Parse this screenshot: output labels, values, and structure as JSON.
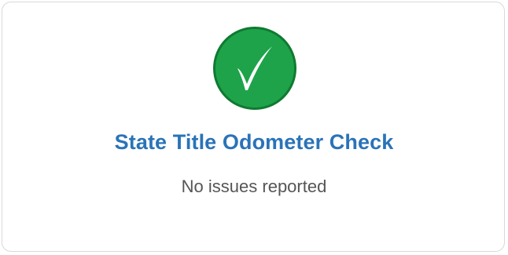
{
  "card": {
    "title": "State Title Odometer Check",
    "status_text": "No issues reported",
    "status_icon": "check-icon",
    "colors": {
      "accent": "#2a73b8",
      "success": "#1ea34a",
      "success_border": "#0f7a31"
    }
  }
}
